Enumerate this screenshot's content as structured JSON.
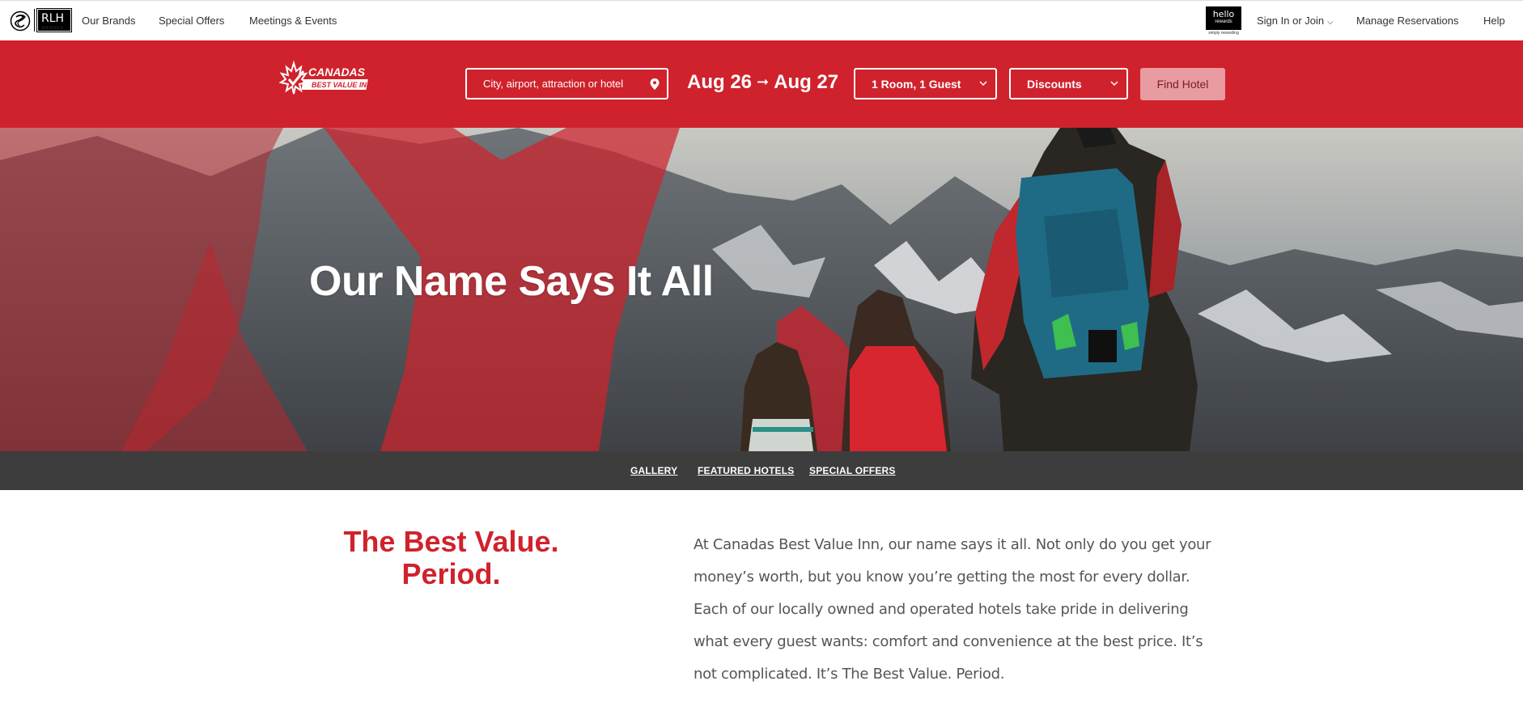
{
  "topnav": {
    "brand_mark": "RLH",
    "brand_sub": "BRANDS",
    "links": [
      "Our Brands",
      "Special Offers",
      "Meetings & Events"
    ],
    "rewards_line1": "hello",
    "rewards_line2": "rewards",
    "rewards_tagline": "simply rewarding",
    "signin": "Sign In or Join",
    "manage": "Manage Reservations",
    "help": "Help"
  },
  "booking": {
    "logo_line1": "CANADAS",
    "logo_line2": "BEST VALUE INN",
    "search_placeholder": "City, airport, attraction or hotel",
    "date_from": "Aug 26",
    "date_to": "Aug 27",
    "rooms_guests": "1 Room, 1 Guest",
    "discounts": "Discounts",
    "find_label": "Find Hotel"
  },
  "hero": {
    "title": "Our Name Says It All"
  },
  "subnav": {
    "items": [
      "GALLERY",
      "FEATURED HOTELS",
      "SPECIAL OFFERS"
    ]
  },
  "intro": {
    "headline_line1": "The Best Value.",
    "headline_line2": "Period.",
    "body": "At Canadas Best Value Inn, our name says it all. Not only do you get your money’s worth, but you know you’re getting the most for every dollar. Each of our locally owned and operated hotels take pride in delivering what every guest wants: comfort and convenience at the best price. It’s not complicated. It’s The Best Value. Period."
  },
  "colors": {
    "brand_red": "#d0222c",
    "subnav_bg": "#3d3d3d",
    "find_button_bg": "#e89ba1"
  }
}
